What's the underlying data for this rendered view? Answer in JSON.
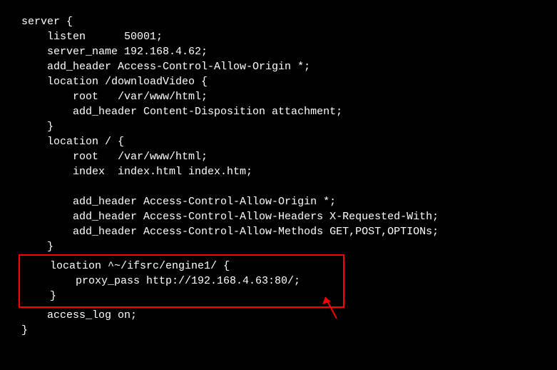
{
  "code": {
    "l1": "server {",
    "l2": "    listen      50001;",
    "l3": "    server_name 192.168.4.62;",
    "l4": "    add_header Access-Control-Allow-Origin *;",
    "l5": "    location /downloadVideo {",
    "l6": "        root   /var/www/html;",
    "l7": "        add_header Content-Disposition attachment;",
    "l8": "    }",
    "l9": "    location / {",
    "l10": "        root   /var/www/html;",
    "l11": "        index  index.html index.htm;",
    "l12": "",
    "l13": "        add_header Access-Control-Allow-Origin *;",
    "l14": "        add_header Access-Control-Allow-Headers X-Requested-With;",
    "l15": "        add_header Access-Control-Allow-Methods GET,POST,OPTIONs;",
    "l16": "    }",
    "h1": "    location ^~/ifsrc/engine1/ {                 ",
    "h2": "        proxy_pass http://192.168.4.63:80/;",
    "h3": "    }",
    "l17": "    access_log on;",
    "l18": "}"
  }
}
